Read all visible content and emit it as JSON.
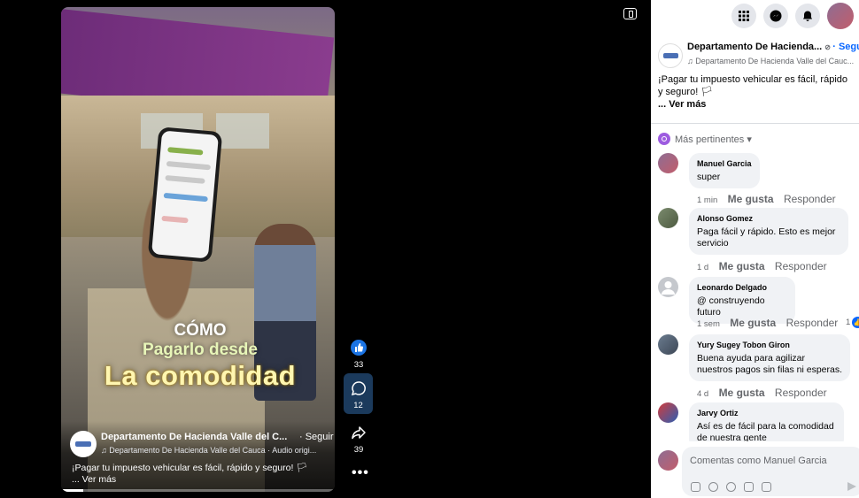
{
  "video": {
    "overlay_line1": "CÓMO",
    "overlay_line2": "Pagarlo desde",
    "overlay_line3": "La comodidad",
    "page_name": "Departamento De Hacienda Valle del C...",
    "follow_label": "· Seguir",
    "audio_text": "♫ Departamento De Hacienda Valle del Cauca · Audio origi...",
    "caption": "¡Pagar tu impuesto vehicular es fácil, rápido y seguro! 🏳",
    "see_more": "... Ver más",
    "progress": 0.08
  },
  "rail": {
    "likes": "33",
    "comments": "12",
    "shares": "39",
    "more": "•••"
  },
  "panel": {
    "page_name": "Departamento De Hacienda...",
    "follow_label": "· Seguir",
    "audio_text": "♫ Departamento De Hacienda Valle del Cauc...",
    "caption": "¡Pagar tu impuesto vehicular es fácil, rápido y seguro! 🏳",
    "see_more": "... Ver más",
    "sort_label": "Más pertinentes ▾",
    "comments": [
      {
        "author": "Manuel Garcia",
        "text": "super",
        "time": "1 min",
        "like": "Me gusta",
        "reply": "Responder",
        "reacts": ""
      },
      {
        "author": "Alonso Gomez",
        "text": "Paga fácil y rápido. Esto es mejor servicio",
        "time": "1 d",
        "like": "Me gusta",
        "reply": "Responder",
        "reacts": ""
      },
      {
        "author": "Leonardo Delgado",
        "text": "@ construyendo futuro",
        "time": "1 sem",
        "like": "Me gusta",
        "reply": "Responder",
        "reacts": "1"
      },
      {
        "author": "Yury Sugey Tobon Giron",
        "text": "Buena ayuda para agilizar nuestros pagos sin filas ni esperas.",
        "time": "4 d",
        "like": "Me gusta",
        "reply": "Responder",
        "reacts": ""
      },
      {
        "author": "Jarvy Ortiz",
        "text": "Así es de fácil para la comodidad de nuestra gente",
        "time": "",
        "like": "",
        "reply": "",
        "reacts": ""
      }
    ],
    "composer_placeholder": "Comentas como Manuel Garcia"
  },
  "icons": [
    "grid-icon",
    "messenger-icon",
    "bell-icon",
    "like-icon",
    "comment-icon",
    "share-icon",
    "sidebar-toggle-icon"
  ],
  "colors": {
    "accent": "#0866ff",
    "bubble": "#f0f2f5",
    "stage": "#000000",
    "overlay_gold": "#fff6b0"
  }
}
